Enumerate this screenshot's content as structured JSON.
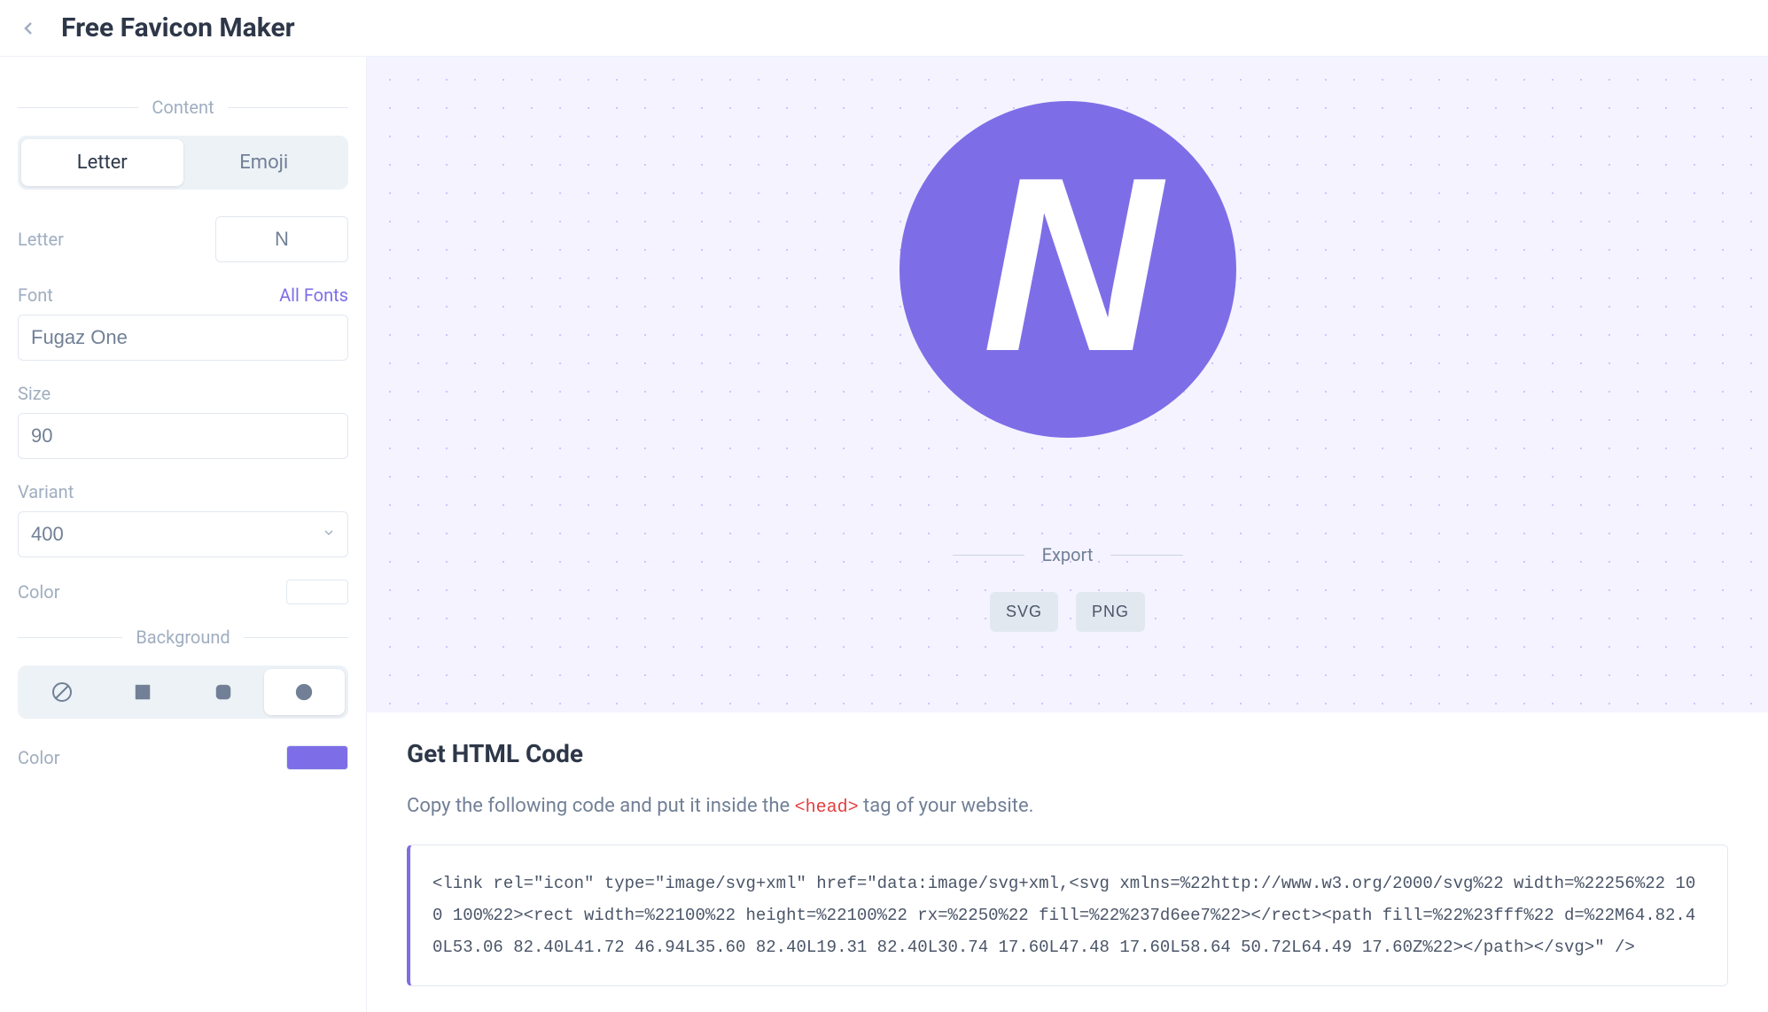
{
  "header": {
    "title": "Free Favicon Maker"
  },
  "sidebar": {
    "content_section_label": "Content",
    "tabs": {
      "letter": "Letter",
      "emoji": "Emoji"
    },
    "letter": {
      "label": "Letter",
      "value": "N"
    },
    "font": {
      "label": "Font",
      "all_fonts_link": "All Fonts",
      "value": "Fugaz One"
    },
    "size": {
      "label": "Size",
      "value": "90"
    },
    "variant": {
      "label": "Variant",
      "value": "400"
    },
    "color": {
      "label": "Color",
      "value": "#ffffff"
    },
    "background_section_label": "Background",
    "background_color": {
      "label": "Color",
      "value": "#7d6ee7"
    }
  },
  "preview": {
    "letter": "N",
    "background_color": "#7d6ee7",
    "text_color": "#ffffff",
    "shape": "circle"
  },
  "export": {
    "label": "Export",
    "svg_button": "SVG",
    "png_button": "PNG"
  },
  "code": {
    "title": "Get HTML Code",
    "description_before": "Copy the following code and put it inside the ",
    "description_tag": "<head>",
    "description_after": " tag of your website.",
    "snippet": "<link rel=\"icon\" type=\"image/svg+xml\" href=\"data:image/svg+xml,<svg xmlns=%22http://www.w3.org/2000/svg%22 width=%22256%22 100 100%22><rect width=%22100%22 height=%22100%22 rx=%2250%22 fill=%22%237d6ee7%22></rect><path fill=%22%23fff%22 d=%22M64.82.40L53.06 82.40L41.72 46.94L35.60 82.40L19.31 82.40L30.74 17.60L47.48 17.60L58.64 50.72L64.49 17.60Z%22></path></svg>\" />"
  }
}
